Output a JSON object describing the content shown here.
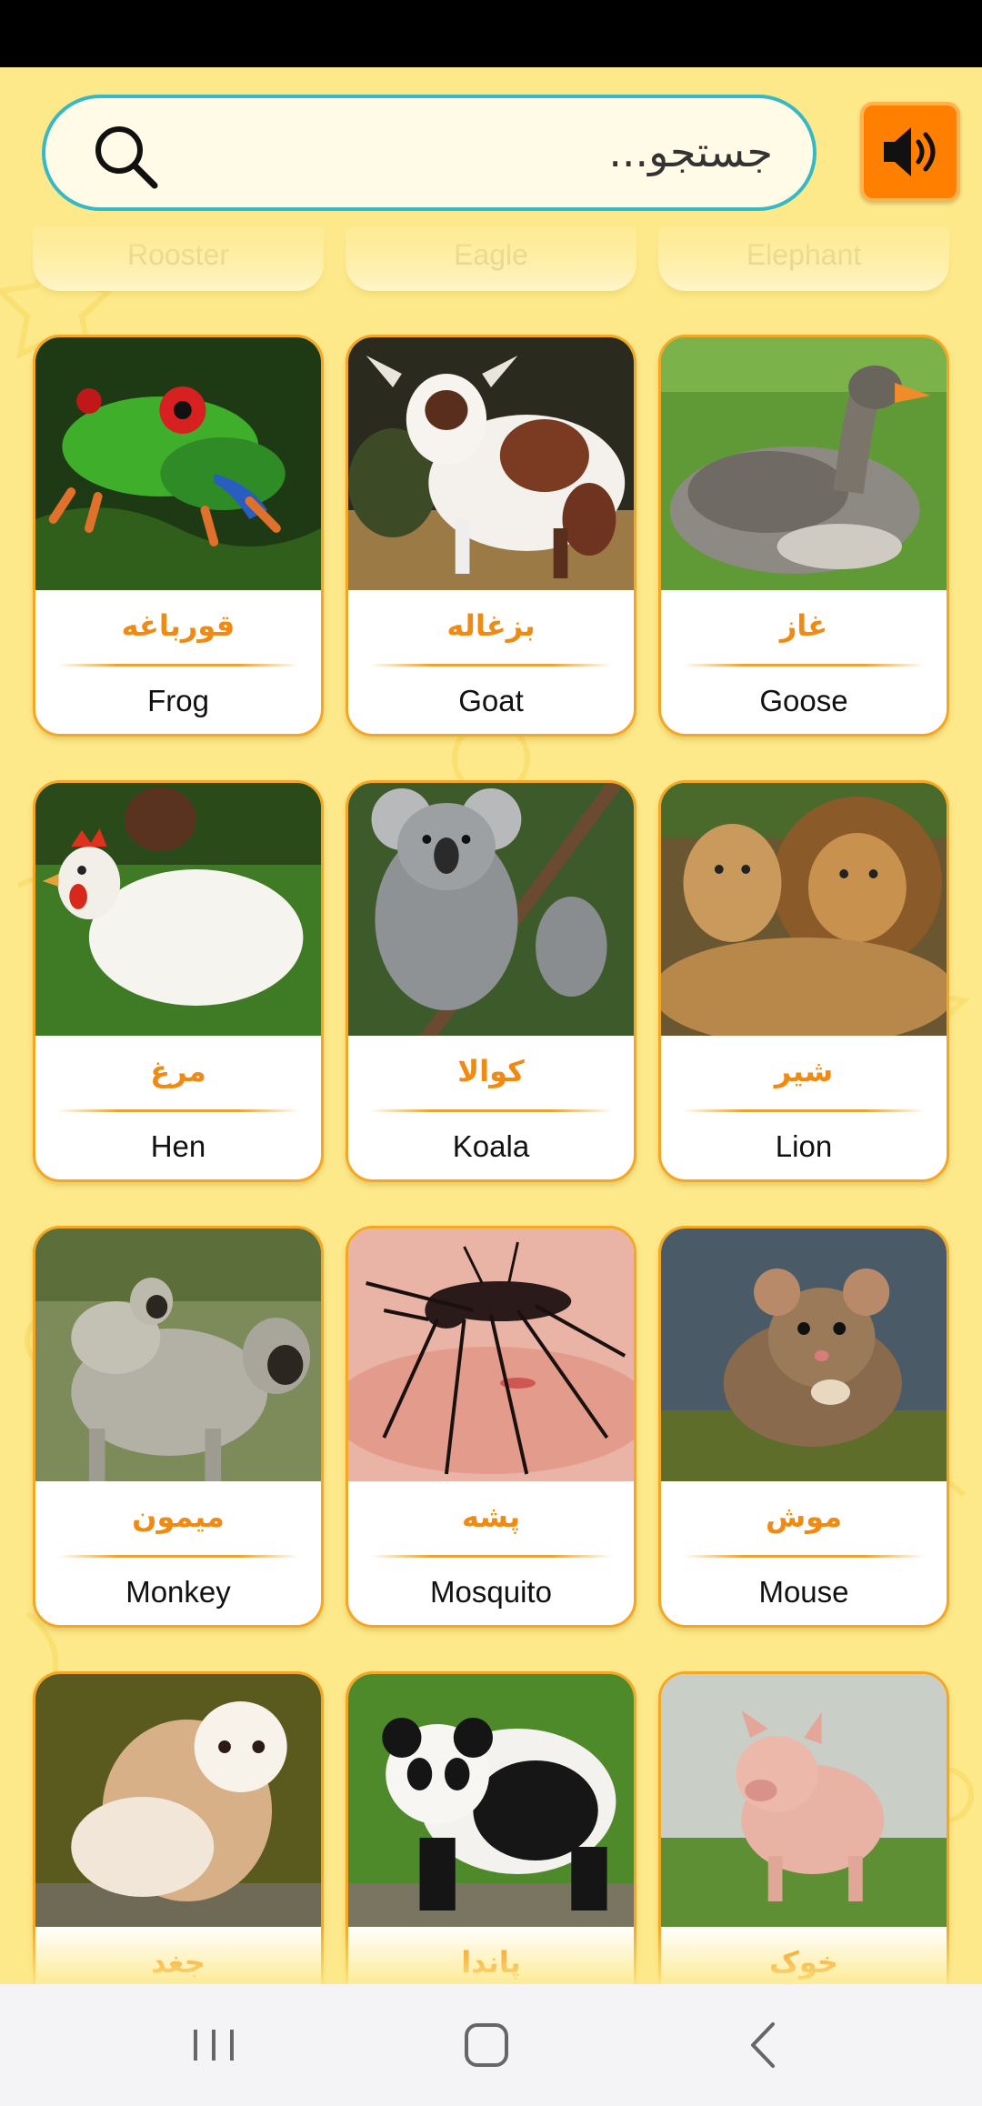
{
  "search": {
    "placeholder": "جستجو..."
  },
  "sound_button": {
    "icon": "speaker-icon",
    "color": "#ff7f00"
  },
  "partial_row_top": [
    "Rooster",
    "Eagle",
    "Elephant"
  ],
  "cards": [
    {
      "en": "Frog",
      "fa": "قورباغه"
    },
    {
      "en": "Goat",
      "fa": "بزغاله"
    },
    {
      "en": "Goose",
      "fa": "غاز"
    },
    {
      "en": "Hen",
      "fa": "مرغ"
    },
    {
      "en": "Koala",
      "fa": "کوالا"
    },
    {
      "en": "Lion",
      "fa": "شیر"
    },
    {
      "en": "Monkey",
      "fa": "میمون"
    },
    {
      "en": "Mosquito",
      "fa": "پشه"
    },
    {
      "en": "Mouse",
      "fa": "موش"
    },
    {
      "en": "",
      "fa": "جغد"
    },
    {
      "en": "",
      "fa": "پاندا"
    },
    {
      "en": "",
      "fa": "خوک"
    }
  ],
  "nav": [
    "recent-apps-icon",
    "home-icon",
    "back-icon"
  ],
  "colors": {
    "accent": "#f08a12",
    "border": "#f5a623",
    "search_border": "#35b9c6",
    "background": "#fde98a"
  }
}
